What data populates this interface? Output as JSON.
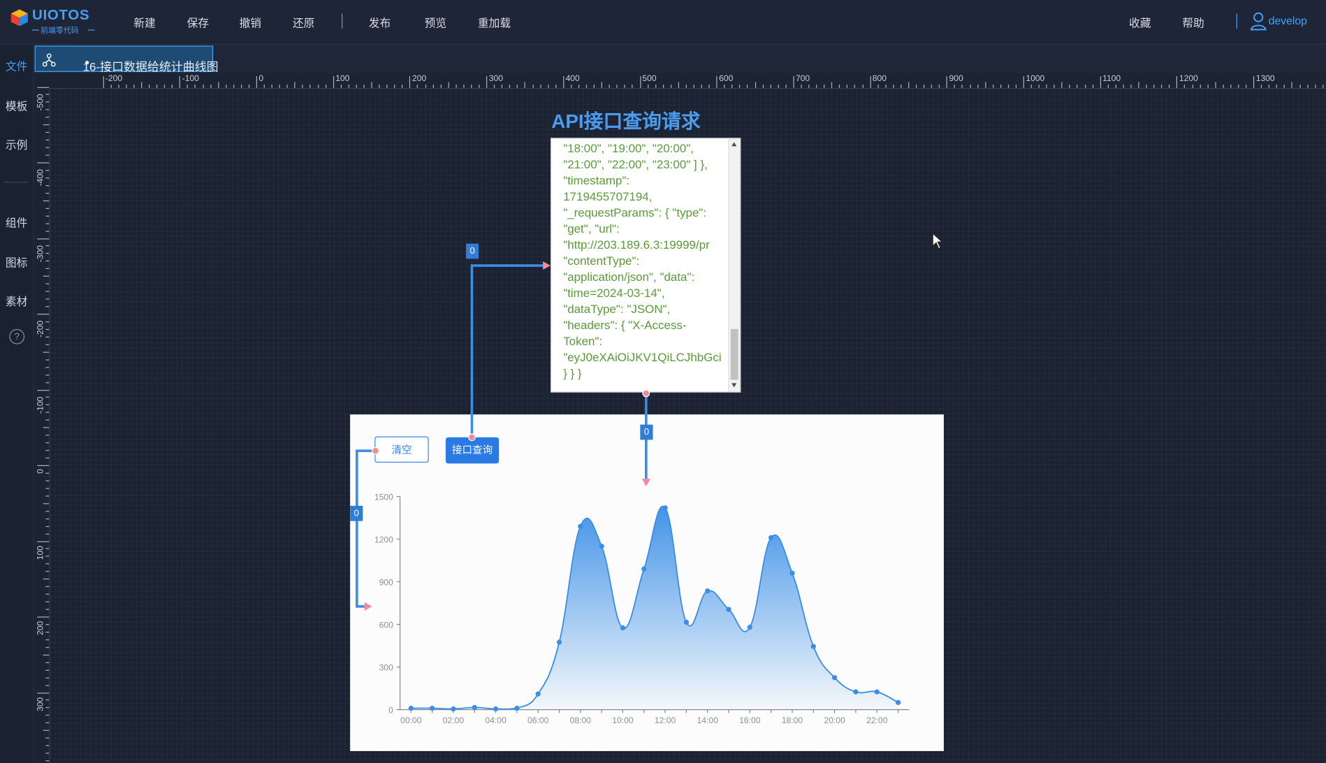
{
  "app": {
    "logo_text": "UIOTOS",
    "logo_sub": "前端零代码"
  },
  "menu": {
    "new": "新建",
    "save": "保存",
    "undo": "撤销",
    "redo": "还原",
    "publish": "发布",
    "preview": "预览",
    "reload": "重加载",
    "favorite": "收藏",
    "help": "帮助",
    "user": "develop"
  },
  "leftrail": {
    "file": "文件",
    "template": "模板",
    "example": "示例",
    "component": "组件",
    "icon": "图标",
    "material": "素材",
    "help_mark": "?"
  },
  "tab": {
    "title": "16-接口数据给统计曲线图",
    "dirty_mark": "●"
  },
  "ruler": {
    "h_labels": [
      "-200",
      "-100",
      "0",
      "100",
      "200",
      "300",
      "400",
      "500",
      "600",
      "700",
      "800",
      "900",
      "1000",
      "1100",
      "1200",
      "1300"
    ],
    "v_labels": [
      "-500",
      "-400",
      "-300",
      "-200",
      "-100",
      "0",
      "100",
      "200",
      "300"
    ]
  },
  "canvas": {
    "api_title": "API接口查询请求",
    "json_text": "\"18:00\", \"19:00\", \"20:00\",\n\"21:00\", \"22:00\", \"23:00\" ] },\n\"timestamp\":\n1719455707194,\n\"_requestParams\": { \"type\":\n\"get\", \"url\":\n\"http://203.189.6.3:19999/pr\n\"contentType\":\n\"application/json\", \"data\":\n\"time=2024-03-14\",\n\"dataType\": \"JSON\",\n\"headers\": { \"X-Access-\nToken\":\n\"eyJ0eXAiOiJKV1QiLCJhbGci\n} } }",
    "btn_clear": "清空",
    "btn_query": "接口查询",
    "badge_top": "0",
    "badge_mid": "0",
    "badge_left": "0"
  },
  "colors": {
    "accent": "#3fa2ff",
    "series": "#3a8ee6",
    "json_text": "#5a9a3a"
  },
  "chart_data": {
    "type": "area",
    "x": [
      "00:00",
      "01:00",
      "02:00",
      "03:00",
      "04:00",
      "05:00",
      "06:00",
      "07:00",
      "08:00",
      "09:00",
      "10:00",
      "11:00",
      "12:00",
      "13:00",
      "14:00",
      "15:00",
      "16:00",
      "17:00",
      "18:00",
      "19:00",
      "20:00",
      "21:00",
      "22:00",
      "23:00"
    ],
    "x_tick_labels": [
      "00:00",
      "02:00",
      "04:00",
      "06:00",
      "08:00",
      "10:00",
      "12:00",
      "14:00",
      "16:00",
      "18:00",
      "20:00",
      "22:00"
    ],
    "values": [
      10,
      10,
      5,
      15,
      5,
      10,
      110,
      475,
      1290,
      1150,
      575,
      990,
      1420,
      615,
      835,
      705,
      580,
      1210,
      960,
      445,
      225,
      125,
      125,
      50
    ],
    "yticks": [
      0,
      300,
      600,
      900,
      1200,
      1500
    ],
    "ylim": [
      0,
      1500
    ],
    "grid": false,
    "smooth": true
  }
}
